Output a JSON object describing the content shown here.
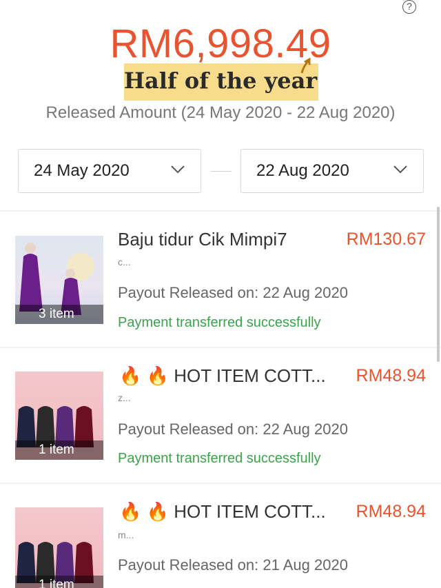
{
  "header": {
    "amount": "RM6,998.49",
    "note": "Half of the year",
    "subtitle": "Released Amount (24 May 2020 - 22 Aug 2020)",
    "help_icon": "question-circle-icon"
  },
  "date_range": {
    "start": "24 May 2020",
    "end": "22 Aug 2020"
  },
  "items": [
    {
      "title": "Baju tidur Cik Mimpi7",
      "price": "RM130.67",
      "variant": "c...",
      "count": "3 item",
      "payout": "Payout Released on: 22 Aug 2020",
      "status": "Payment transferred successfully"
    },
    {
      "title": "🔥 🔥 HOT ITEM COTT...",
      "price": "RM48.94",
      "variant": "z...",
      "count": "1 item",
      "payout": "Payout Released on: 22 Aug 2020",
      "status": "Payment transferred successfully"
    },
    {
      "title": "🔥 🔥 HOT ITEM COTT...",
      "price": "RM48.94",
      "variant": "m...",
      "count": "1 item",
      "payout": "Payout Released on: 21 Aug 2020",
      "status": ""
    }
  ],
  "colors": {
    "accent": "#e8542f",
    "success": "#3aa34b",
    "highlight": "#f7dc8c"
  }
}
